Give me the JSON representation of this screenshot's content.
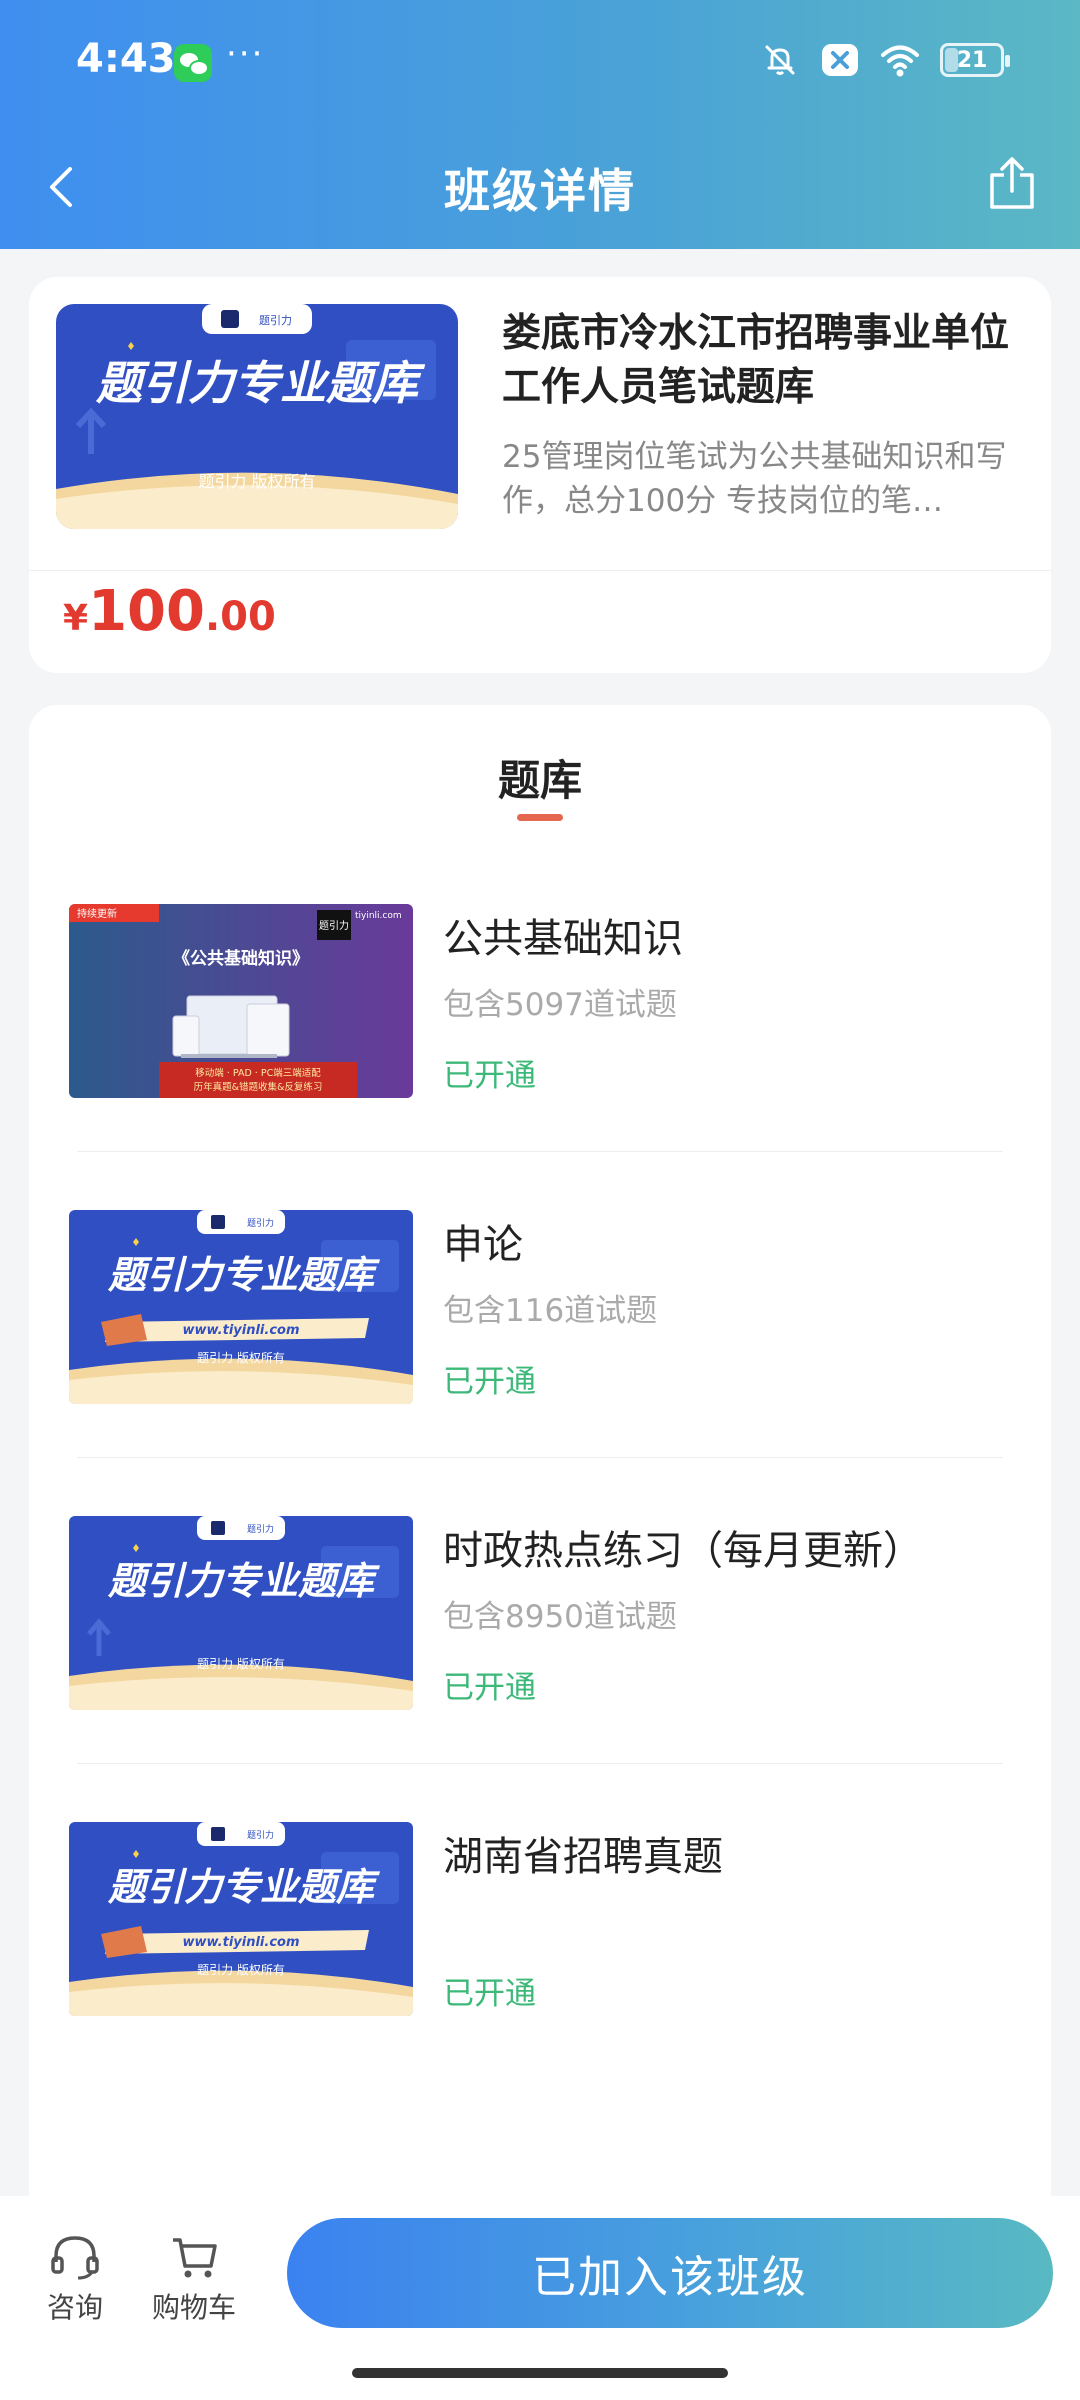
{
  "status_bar": {
    "time": "4:43",
    "more": "···",
    "battery": "21"
  },
  "nav": {
    "title": "班级详情"
  },
  "course": {
    "thumb": {
      "brand": "题引力",
      "headline": "题引力专业题库",
      "footer": "题引力 版权所有"
    },
    "title": "娄底市冷水江市招聘事业单位工作人员笔试题库",
    "description": "25管理岗位笔试为公共基础知识和写作，总分100分 专技岗位的笔…",
    "price": {
      "symbol": "¥",
      "integer": "100",
      "decimal": ".00"
    }
  },
  "bank": {
    "section_title": "题库",
    "items": [
      {
        "name": "公共基础知识",
        "count": "包含5097道试题",
        "status": "已开通",
        "thumb": {
          "tag": "持续更新",
          "logo": "题引力",
          "site": "tiyinli.com",
          "headline": "《公共基础知识》",
          "line1": "移动端 · PAD · PC端三端适配",
          "line2": "历年真题&错题收集&反复练习"
        }
      },
      {
        "name": "申论",
        "count": "包含116道试题",
        "status": "已开通",
        "thumb": {
          "brand": "题引力",
          "headline": "题引力专业题库",
          "site": "www.tiyinli.com",
          "footer": "题引力 版权所有"
        }
      },
      {
        "name": "时政热点练习（每月更新）",
        "count": "包含8950道试题",
        "status": "已开通",
        "thumb": {
          "brand": "题引力",
          "headline": "题引力专业题库",
          "footer": "题引力 版权所有"
        }
      },
      {
        "name": "湖南省招聘真题",
        "count": "",
        "status": "已开通",
        "thumb": {
          "brand": "题引力",
          "headline": "题引力专业题库",
          "site": "www.tiyinli.com",
          "footer": "题引力 版权所有"
        }
      }
    ]
  },
  "bottom": {
    "consult": "咨询",
    "cart": "购物车",
    "join_button": "已加入该班级"
  },
  "colors": {
    "header_start": "#3f8ef0",
    "header_end": "#5bb8c4",
    "price": "#e23a2e",
    "status_open": "#3cb878",
    "tab_underline": "#e6674f",
    "thumb_blue": "#2f4fc2"
  },
  "icons": {
    "status": [
      "wechat-icon",
      "bell-off-icon",
      "close-box-icon",
      "wifi-icon",
      "battery-icon"
    ],
    "nav": [
      "back-icon",
      "share-icon"
    ],
    "bottom": [
      "headset-icon",
      "cart-icon"
    ]
  }
}
